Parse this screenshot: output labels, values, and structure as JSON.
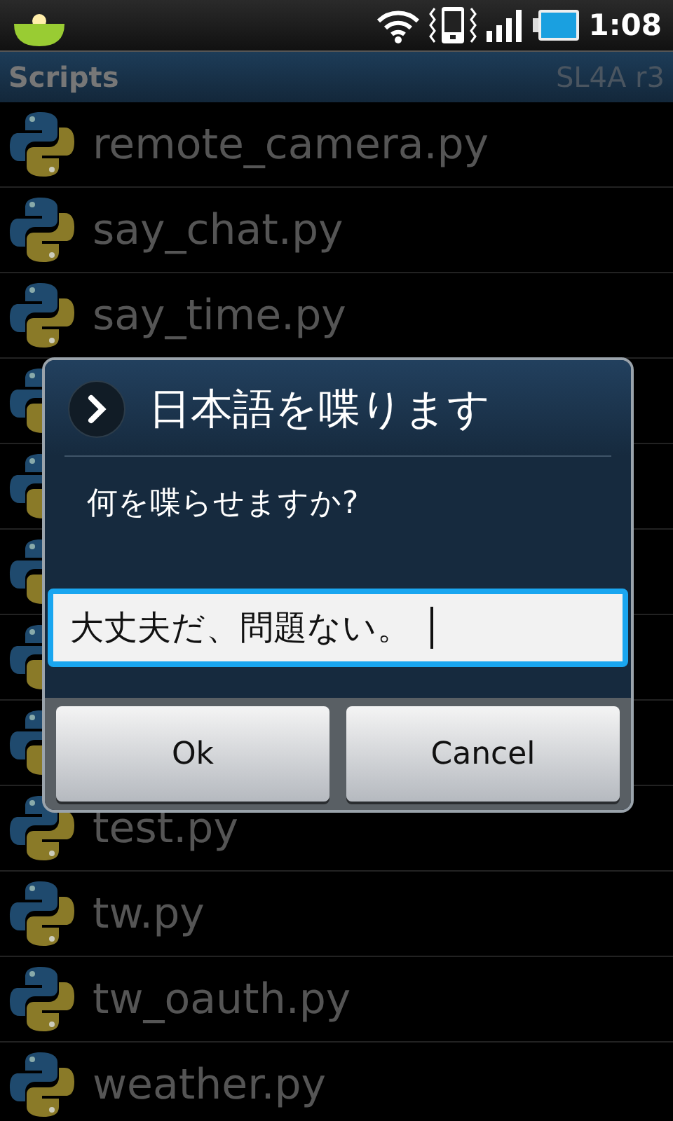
{
  "status_bar": {
    "time": "1:08"
  },
  "action_bar": {
    "title": "Scripts",
    "version": "SL4A r3"
  },
  "scripts": [
    {
      "kind": "file",
      "name": "remote_camera.py"
    },
    {
      "kind": "file",
      "name": "say_chat.py"
    },
    {
      "kind": "file",
      "name": "say_time.py"
    },
    {
      "kind": "covered"
    },
    {
      "kind": "covered"
    },
    {
      "kind": "covered"
    },
    {
      "kind": "covered"
    },
    {
      "kind": "covered"
    },
    {
      "kind": "file",
      "name": "test.py"
    },
    {
      "kind": "file",
      "name": "tw.py"
    },
    {
      "kind": "file",
      "name": "tw_oauth.py"
    },
    {
      "kind": "file",
      "name": "weather.py"
    }
  ],
  "dialog": {
    "title": "日本語を喋ります",
    "message": "何を喋らせますか?",
    "input": {
      "value": "大丈夫だ、問題ない。"
    },
    "buttons": [
      "Ok",
      "Cancel"
    ]
  }
}
